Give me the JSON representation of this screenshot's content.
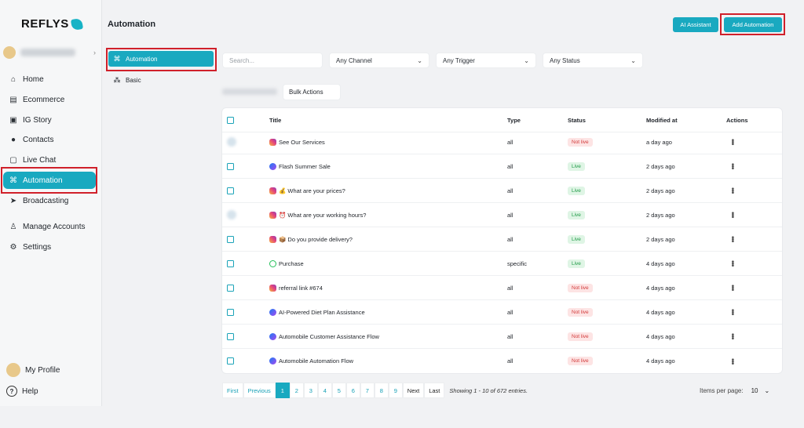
{
  "brand": "REFLYS",
  "sidebar": {
    "items": [
      {
        "label": "Home",
        "icon": "home-icon"
      },
      {
        "label": "Ecommerce",
        "icon": "store-icon"
      },
      {
        "label": "IG Story",
        "icon": "image-icon"
      },
      {
        "label": "Contacts",
        "icon": "users-icon"
      },
      {
        "label": "Live Chat",
        "icon": "chat-icon"
      },
      {
        "label": "Automation",
        "icon": "automation-icon",
        "active": true
      },
      {
        "label": "Broadcasting",
        "icon": "send-icon"
      },
      {
        "label": "Manage Accounts",
        "icon": "user-settings-icon"
      },
      {
        "label": "Settings",
        "icon": "gear-icon"
      }
    ],
    "profile": "My Profile",
    "help": "Help"
  },
  "header": {
    "title": "Automation",
    "ai_button": "AI Assistant",
    "add_button": "Add Automation"
  },
  "submenu": [
    {
      "label": "Automation",
      "active": true
    },
    {
      "label": "Basic"
    }
  ],
  "filters": {
    "search_placeholder": "Search...",
    "channel": "Any Channel",
    "trigger": "Any Trigger",
    "status": "Any Status"
  },
  "bulk_actions": "Bulk Actions",
  "table": {
    "headers": {
      "title": "Title",
      "type": "Type",
      "status": "Status",
      "modified": "Modified at",
      "actions": "Actions"
    },
    "rows": [
      {
        "title": "See Our Services",
        "channel": "instagram",
        "type": "all",
        "status": "Not live",
        "modified": "a day ago",
        "blurred": true
      },
      {
        "title": "Flash Summer Sale",
        "channel": "messenger",
        "type": "all",
        "status": "Live",
        "modified": "2 days ago"
      },
      {
        "title": "💰 What are your prices?",
        "channel": "instagram",
        "type": "all",
        "status": "Live",
        "modified": "2 days ago"
      },
      {
        "title": "⏰ What are your working hours?",
        "channel": "instagram",
        "type": "all",
        "status": "Live",
        "modified": "2 days ago",
        "blurred": true
      },
      {
        "title": "📦 Do you provide delivery?",
        "channel": "instagram",
        "type": "all",
        "status": "Live",
        "modified": "2 days ago"
      },
      {
        "title": "Purchase",
        "channel": "whatsapp",
        "type": "specific",
        "status": "Live",
        "modified": "4 days ago"
      },
      {
        "title": "referral link #674",
        "channel": "instagram",
        "type": "all",
        "status": "Not live",
        "modified": "4 days ago"
      },
      {
        "title": "AI-Powered Diet Plan Assistance",
        "channel": "messenger",
        "type": "all",
        "status": "Not live",
        "modified": "4 days ago"
      },
      {
        "title": "Automobile Customer Assistance Flow",
        "channel": "messenger",
        "type": "all",
        "status": "Not live",
        "modified": "4 days ago"
      },
      {
        "title": "Automobile Automation Flow",
        "channel": "messenger",
        "type": "all",
        "status": "Not live",
        "modified": "4 days ago"
      }
    ]
  },
  "pagination": {
    "first": "First",
    "previous": "Previous",
    "pages": [
      "1",
      "2",
      "3",
      "4",
      "5",
      "6",
      "7",
      "8",
      "9"
    ],
    "current": "1",
    "next": "Next",
    "last": "Last",
    "summary": "Showing 1 - 10 of 672 entries.",
    "per_page_label": "Items per page:",
    "per_page_value": "10"
  },
  "colors": {
    "accent": "#19a9c0",
    "highlight": "#d0202a"
  }
}
